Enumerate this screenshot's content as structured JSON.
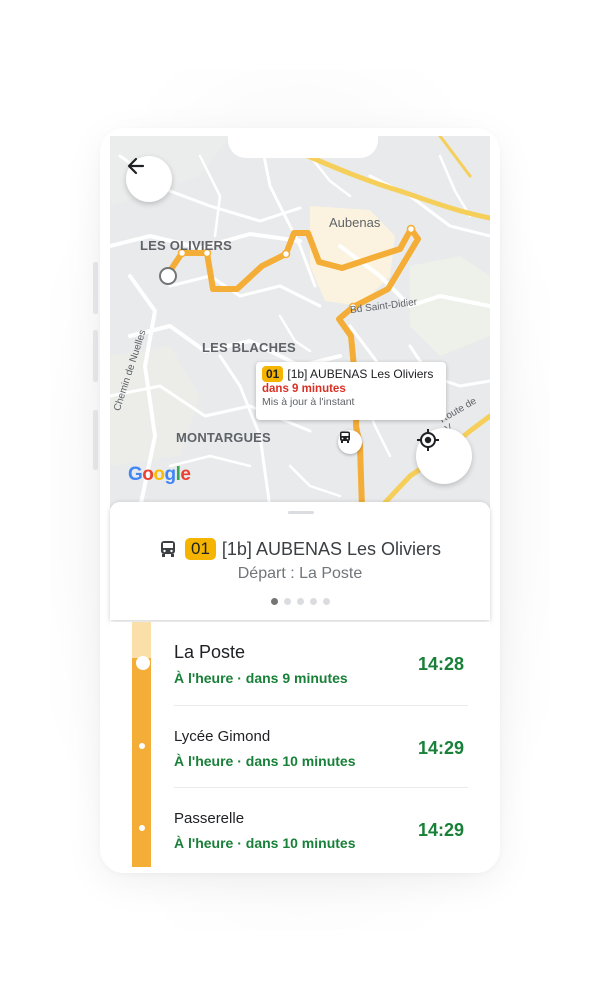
{
  "map": {
    "town_label": "Aubenas",
    "district_labels": [
      "LES OLIVIERS",
      "LES BLACHES",
      "MONTARGUES"
    ],
    "road_labels": [
      "Bd Saint-Didier",
      "Chemin de Nuelles",
      "Route de V"
    ],
    "logo_text": "Google",
    "route_color": "#F4AD36"
  },
  "bubble": {
    "line_badge": "01",
    "title": "[1b] AUBENAS Les Oliviers",
    "eta": "dans 9 minutes",
    "updated": "Mis à jour à l'instant"
  },
  "sheet": {
    "line_badge": "01",
    "title": "[1b] AUBENAS Les Oliviers",
    "subtitle": "Départ : La Poste",
    "page_count": 5,
    "active_page": 1
  },
  "stops": [
    {
      "name": "La Poste",
      "status": "À l'heure · dans 9 minutes",
      "time": "14:28"
    },
    {
      "name": "Lycée Gimond",
      "status": "À l'heure · dans 10 minutes",
      "time": "14:29"
    },
    {
      "name": "Passerelle",
      "status": "À l'heure · dans 10 minutes",
      "time": "14:29"
    }
  ],
  "colors": {
    "accent": "#F4B400",
    "on_time": "#188038",
    "eta_red": "#D93025"
  }
}
